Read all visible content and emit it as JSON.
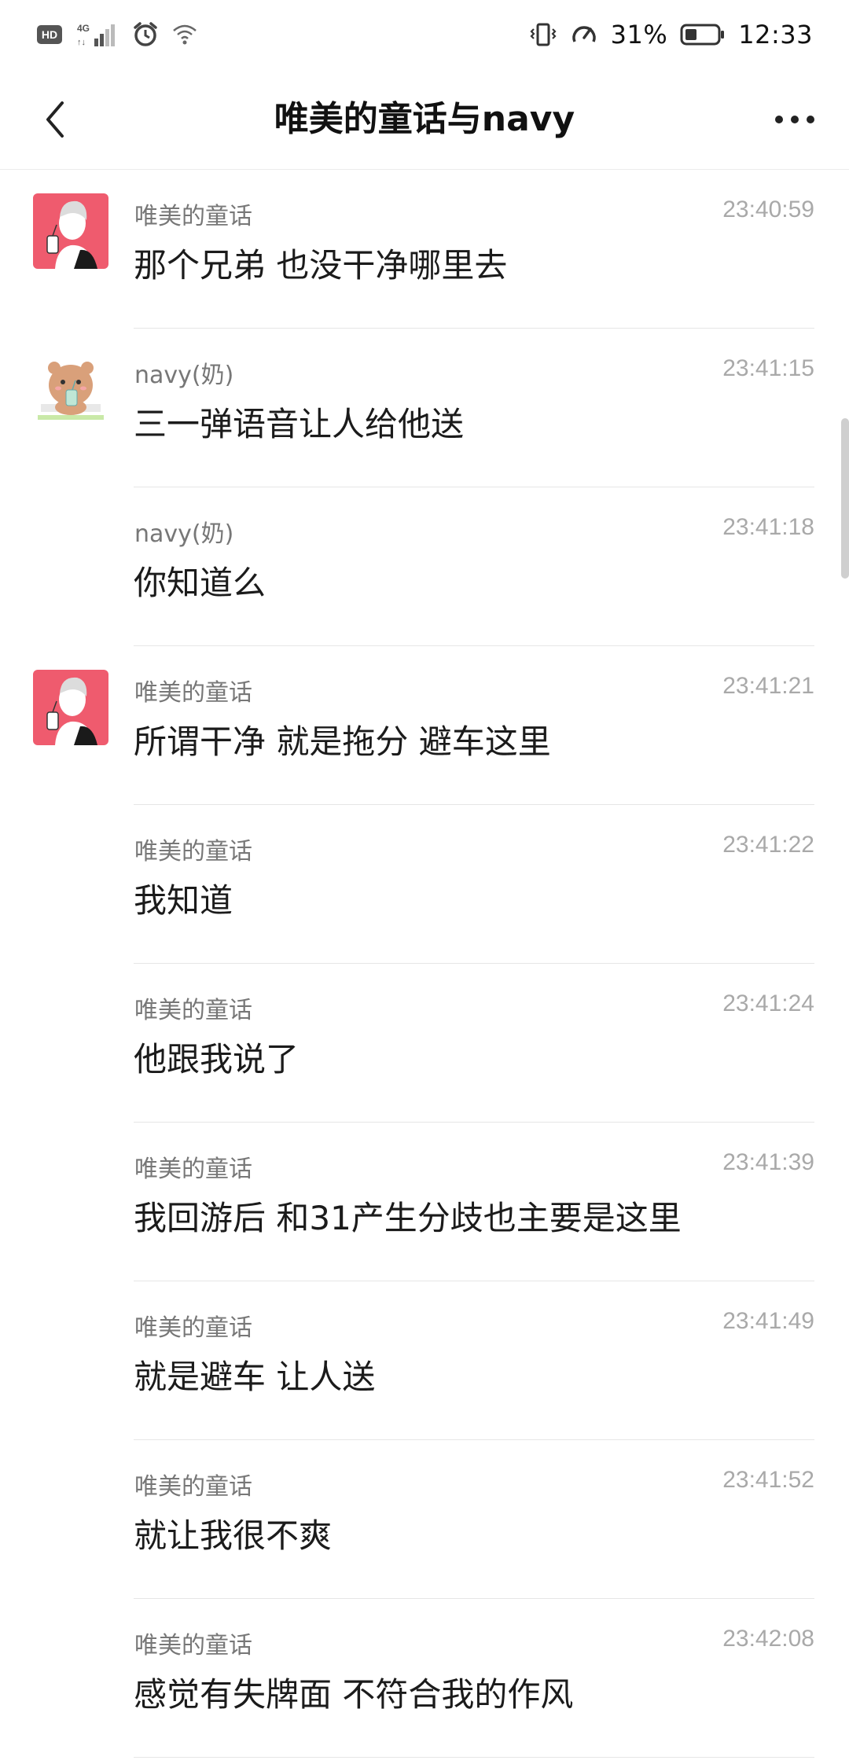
{
  "status_bar": {
    "hd_label": "HD",
    "network_label": "4G",
    "battery_percent": "31%",
    "time": "12:33"
  },
  "header": {
    "title": "唯美的童话与navy"
  },
  "messages": [
    {
      "sender": "唯美的童话",
      "time": "23:40:59",
      "text": "那个兄弟 也没干净哪里去"
    },
    {
      "sender": "navy(奶)",
      "time": "23:41:15",
      "text": "三一弹语音让人给他送"
    },
    {
      "sender": "navy(奶)",
      "time": "23:41:18",
      "text": "你知道么"
    },
    {
      "sender": "唯美的童话",
      "time": "23:41:21",
      "text": "所谓干净 就是拖分 避车这里"
    },
    {
      "sender": "唯美的童话",
      "time": "23:41:22",
      "text": "我知道"
    },
    {
      "sender": "唯美的童话",
      "time": "23:41:24",
      "text": "他跟我说了"
    },
    {
      "sender": "唯美的童话",
      "time": "23:41:39",
      "text": "我回游后 和31产生分歧也主要是这里"
    },
    {
      "sender": "唯美的童话",
      "time": "23:41:49",
      "text": "就是避车 让人送"
    },
    {
      "sender": "唯美的童话",
      "time": "23:41:52",
      "text": "就让我很不爽"
    },
    {
      "sender": "唯美的童话",
      "time": "23:42:08",
      "text": "感觉有失牌面 不符合我的作风"
    }
  ],
  "colors": {
    "avatar_pink": "#ef5b6e",
    "avatar_bear": "#d9a07a"
  }
}
